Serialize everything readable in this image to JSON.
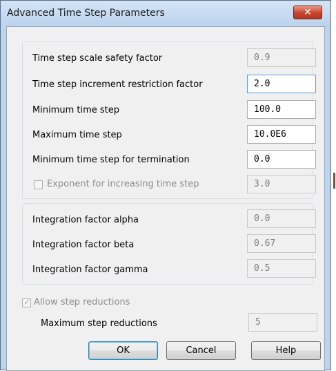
{
  "window": {
    "title": "Advanced Time Step Parameters",
    "close_glyph": "✕"
  },
  "step": {
    "rows": [
      {
        "label": "Time step scale safety factor",
        "value": "0.9",
        "enabled": false
      },
      {
        "label": "Time step increment restriction factor",
        "value": "2.0",
        "enabled": true
      },
      {
        "label": "Minimum time step",
        "value": "100.0",
        "enabled": true
      },
      {
        "label": "Maximum time step",
        "value": "10.0E6",
        "enabled": true
      },
      {
        "label": "Minimum time step for termination",
        "value": "0.0",
        "enabled": true
      }
    ],
    "exponent": {
      "label": "Exponent for increasing time step",
      "checked": false,
      "value": "3.0"
    }
  },
  "integration": {
    "rows": [
      {
        "label": "Integration factor alpha",
        "value": "0.0"
      },
      {
        "label": "Integration factor beta",
        "value": "0.67"
      },
      {
        "label": "Integration factor gamma",
        "value": "0.5"
      }
    ]
  },
  "reductions": {
    "allow_label": "Allow step reductions",
    "allow_checked": true,
    "max_label": "Maximum step reductions",
    "max_value": "5"
  },
  "buttons": {
    "ok": "OK",
    "cancel": "Cancel",
    "help": "Help"
  }
}
